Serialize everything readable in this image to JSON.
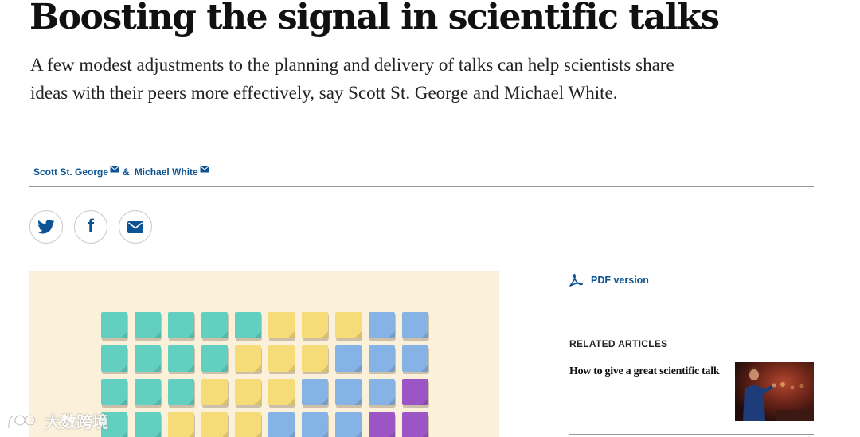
{
  "article": {
    "headline": "Boosting the signal in scientific talks",
    "standfirst": "A few modest adjustments to the planning and delivery of talks can help scientists share ideas with their peers more effectively, say Scott St. George and Michael White.",
    "authors": [
      {
        "name": "Scott St. George",
        "icon": "envelope-icon"
      },
      {
        "name": "Michael White",
        "icon": "envelope-icon"
      }
    ],
    "author_separator": "&"
  },
  "share": [
    {
      "network": "twitter",
      "icon": "twitter-icon"
    },
    {
      "network": "facebook",
      "icon": "facebook-icon",
      "glyph": "f"
    },
    {
      "network": "email",
      "icon": "envelope-icon"
    }
  ],
  "figure": {
    "description_colors": {
      "background": "#fbf0da",
      "teal": "#62cfc0",
      "yellow": "#f6dc79",
      "blue": "#86b3e6",
      "purple": "#9b55c4"
    },
    "rows": [
      [
        "teal",
        "teal",
        "teal",
        "teal",
        "teal",
        "yellow",
        "yellow",
        "yellow",
        "blue",
        "blue"
      ],
      [
        "teal",
        "teal",
        "teal",
        "teal",
        "yellow",
        "yellow",
        "yellow",
        "blue",
        "blue",
        "blue"
      ],
      [
        "teal",
        "teal",
        "teal",
        "yellow",
        "yellow",
        "yellow",
        "blue",
        "blue",
        "blue",
        "purple"
      ],
      [
        "teal",
        "teal",
        "yellow",
        "yellow",
        "yellow",
        "blue",
        "blue",
        "blue",
        "purple",
        "purple"
      ]
    ]
  },
  "sidebar": {
    "pdf_label": "PDF version",
    "pdf_icon": "pdf-icon",
    "related_heading": "RELATED ARTICLES",
    "related": [
      {
        "title": "How to give a great scientific talk"
      }
    ]
  },
  "watermark": {
    "text": "大数跨境"
  },
  "colors": {
    "link": "#0b5394",
    "divider": "#999999"
  }
}
